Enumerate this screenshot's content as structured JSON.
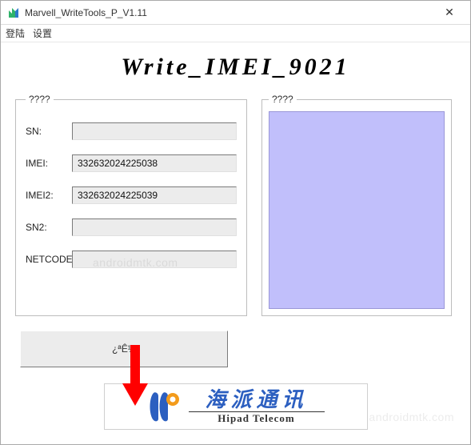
{
  "window": {
    "title": "Marvell_WriteTools_P_V1.11",
    "close_label": "✕"
  },
  "menu": {
    "login": "登陆",
    "settings": "设置"
  },
  "headline": "Write_IMEI_9021",
  "groups": {
    "inputs_legend": "????",
    "preview_legend": "????"
  },
  "fields": {
    "sn": {
      "label": "SN:",
      "value": ""
    },
    "imei": {
      "label": "IMEI:",
      "value": "332632024225038"
    },
    "imei2": {
      "label": "IMEI2:",
      "value": "332632024225039"
    },
    "sn2": {
      "label": "SN2:",
      "value": ""
    },
    "netcode": {
      "label": "NETCODE",
      "value": ""
    }
  },
  "actions": {
    "write_button": "¿ªÊ¼"
  },
  "logo": {
    "cn": "海派通讯",
    "en": "Hipad Telecom"
  },
  "colors": {
    "preview_bg": "#c1bffb",
    "arrow": "#ff0000",
    "logo_blue": "#2c5fc0",
    "logo_orange": "#f39b1b"
  },
  "watermark": "androidmtk.com"
}
